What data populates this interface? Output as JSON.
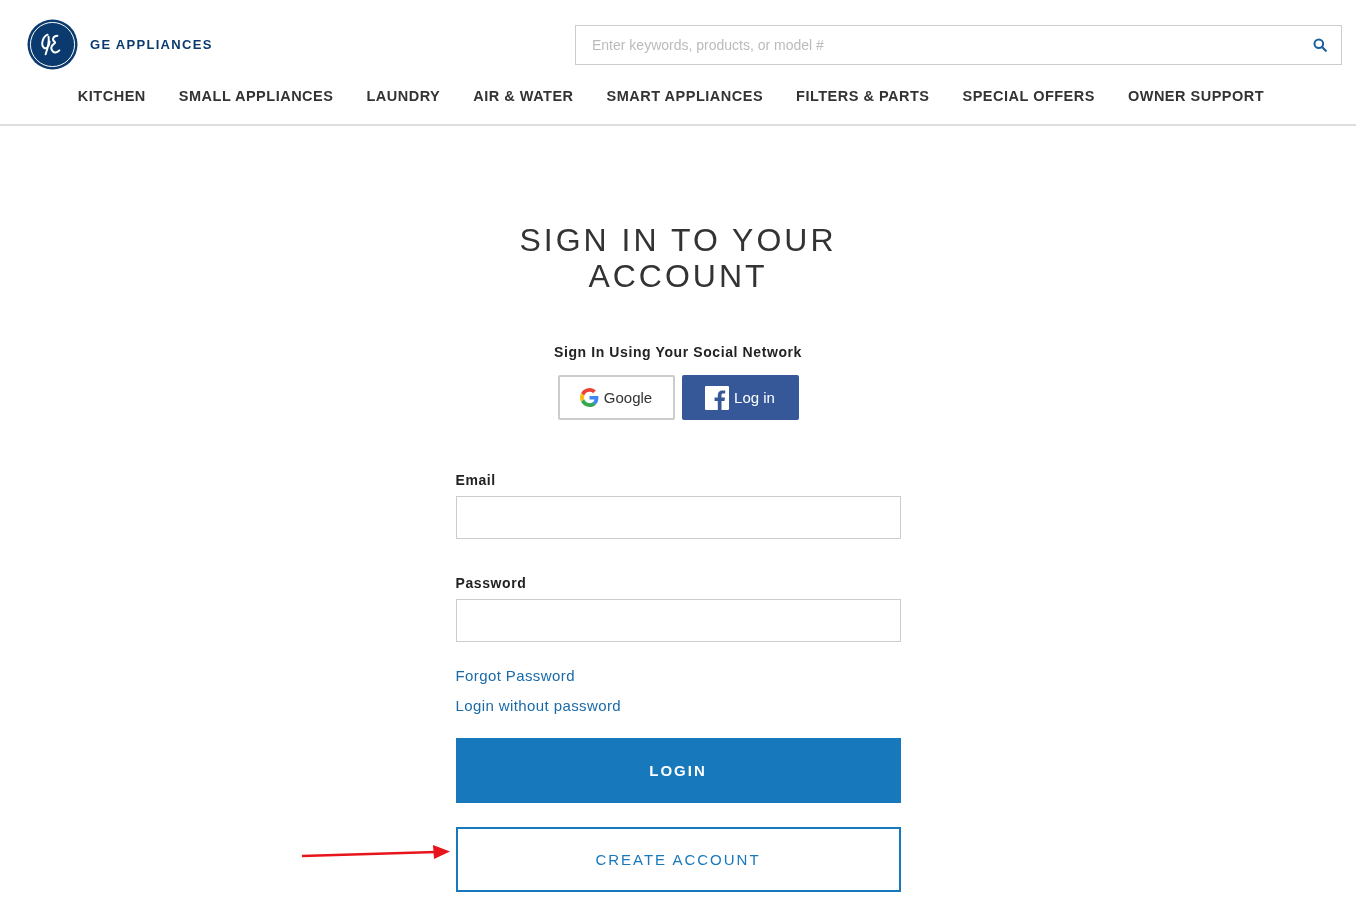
{
  "header": {
    "brand": "GE APPLIANCES",
    "search": {
      "placeholder": "Enter keywords, products, or model #"
    }
  },
  "nav": [
    "KITCHEN",
    "SMALL APPLIANCES",
    "LAUNDRY",
    "AIR & WATER",
    "SMART APPLIANCES",
    "FILTERS & PARTS",
    "SPECIAL OFFERS",
    "OWNER SUPPORT"
  ],
  "signin": {
    "title": "SIGN IN TO YOUR ACCOUNT",
    "social_heading": "Sign In Using Your Social Network",
    "social_buttons": [
      {
        "kind": "google",
        "label": "Google"
      },
      {
        "kind": "facebook",
        "label": "Log in"
      }
    ],
    "fields": [
      {
        "label": "Email"
      },
      {
        "label": "Password"
      }
    ],
    "links": [
      "Forgot Password",
      "Login without password"
    ],
    "login_button": "LOGIN",
    "create_button": "CREATE ACCOUNT"
  }
}
